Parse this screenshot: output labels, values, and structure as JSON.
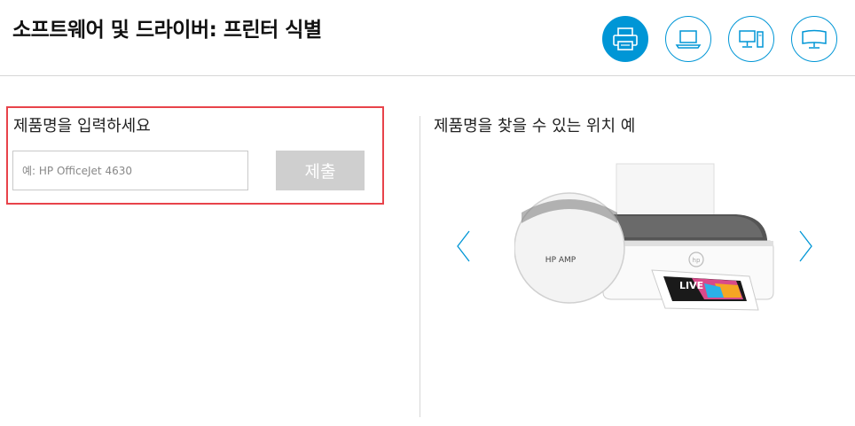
{
  "header": {
    "title": "소프트웨어 및 드라이버: 프린터 식별",
    "categories": [
      {
        "name": "printer",
        "icon": "printer-icon",
        "active": true
      },
      {
        "name": "laptop",
        "icon": "laptop-icon",
        "active": false
      },
      {
        "name": "desktop",
        "icon": "desktop-icon",
        "active": false
      },
      {
        "name": "monitor",
        "icon": "monitor-icon",
        "active": false
      }
    ]
  },
  "form": {
    "label": "제품명을 입력하세요",
    "placeholder": "예: HP OfficeJet 4630",
    "submit_label": "제출"
  },
  "example": {
    "title": "제품명을 찾을 수 있는 위치 예",
    "zoom_label": "HP AMP",
    "paper_text": "LIVE"
  },
  "colors": {
    "accent": "#0096d6",
    "highlight_border": "#e8434a",
    "disabled_button": "#cfcfcf"
  }
}
